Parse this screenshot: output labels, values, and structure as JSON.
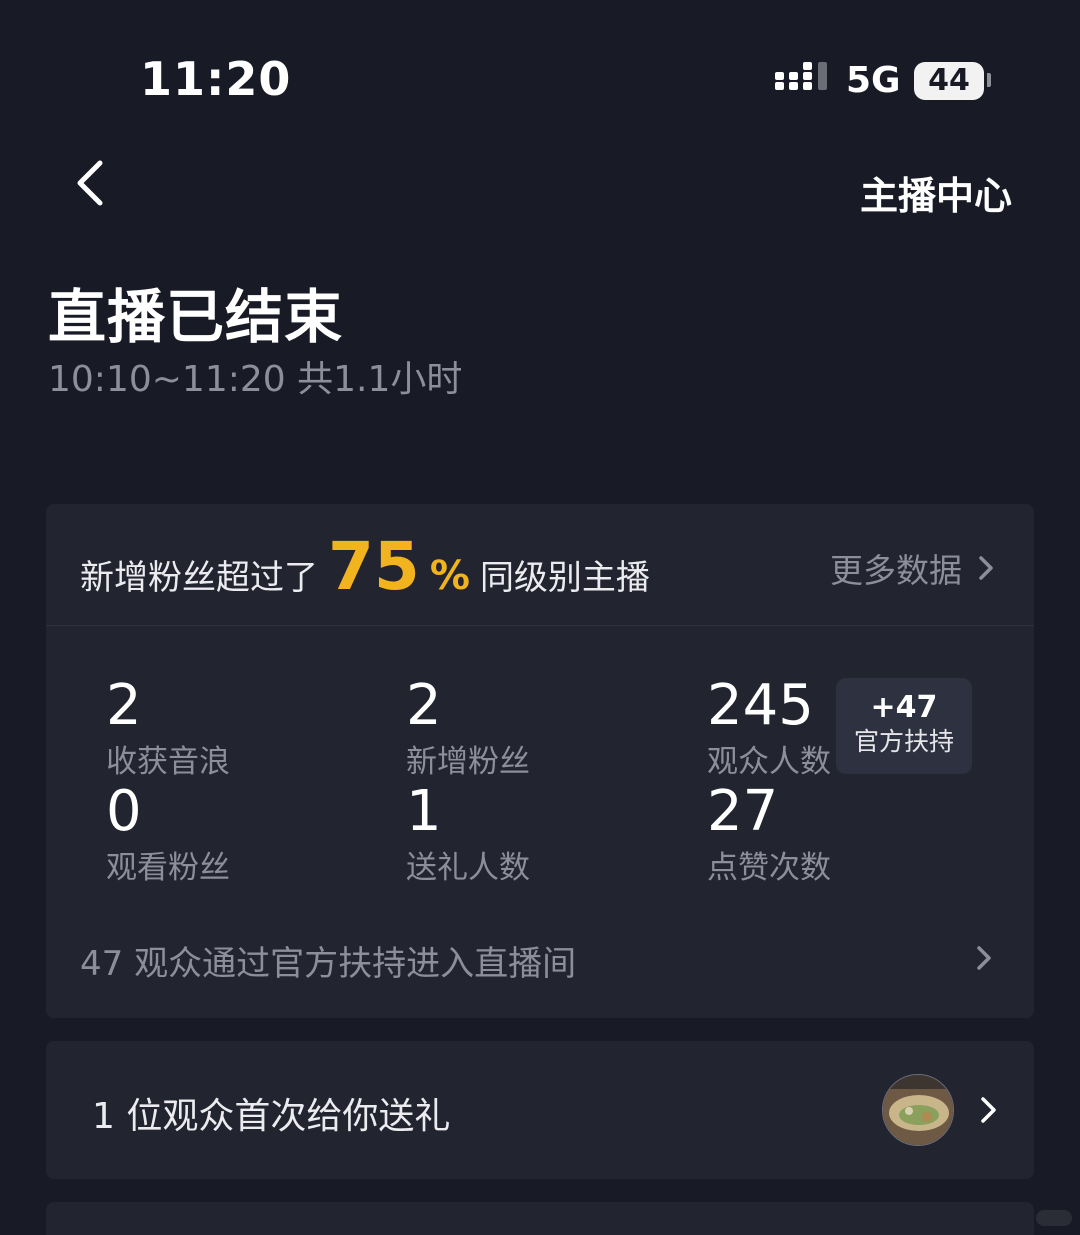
{
  "status_bar": {
    "time": "11:20",
    "network": "5G",
    "battery": "44"
  },
  "nav": {
    "right_label": "主播中心"
  },
  "header": {
    "title": "直播已结束",
    "subtitle": "10:10~11:20 共1.1小时"
  },
  "summary": {
    "prefix": "新增粉丝超过了",
    "percent": "75",
    "percent_sign": "%",
    "suffix": "同级别主播",
    "more_label": "更多数据"
  },
  "stats": [
    {
      "value": "2",
      "label": "收获音浪"
    },
    {
      "value": "2",
      "label": "新增粉丝"
    },
    {
      "value": "245",
      "label": "观众人数"
    },
    {
      "value": "0",
      "label": "观看粉丝"
    },
    {
      "value": "1",
      "label": "送礼人数"
    },
    {
      "value": "27",
      "label": "点赞次数"
    }
  ],
  "support_badge": {
    "count": "+47",
    "label": "官方扶持"
  },
  "support_row": {
    "text": "47 观众通过官方扶持进入直播间"
  },
  "gift": {
    "text": "1 位观众首次给你送礼"
  },
  "icons": {
    "back": "chevron-left-icon",
    "more": "chevron-right-icon",
    "signal": "signal-icon",
    "avatar": "avatar"
  },
  "colors": {
    "background": "#181a26",
    "card": "#22242f",
    "accent": "#f2b41e",
    "muted_text": "#8c8e99"
  }
}
